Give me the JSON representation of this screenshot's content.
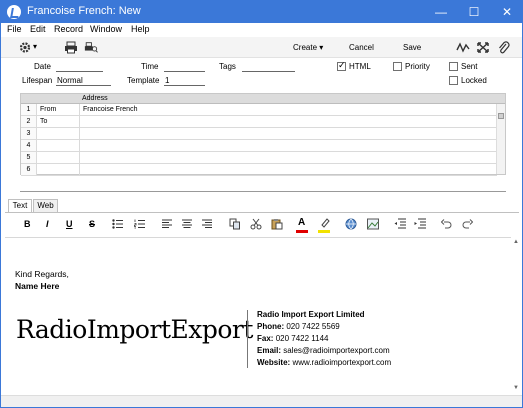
{
  "window": {
    "title": "Francoise French: New"
  },
  "window_controls": {
    "minimize": "—",
    "maximize": "☐",
    "close": "✕"
  },
  "menu": {
    "file": "File",
    "edit": "Edit",
    "record": "Record",
    "window": "Window",
    "help": "Help"
  },
  "toolbar": {
    "create": "Create",
    "cancel": "Cancel",
    "save": "Save",
    "caret": "▾"
  },
  "header": {
    "date_label": "Date",
    "date_value": "",
    "time_label": "Time",
    "time_value": "",
    "tags_label": "Tags",
    "tags_value": "",
    "html_label": "HTML",
    "html_checked": true,
    "priority_label": "Priority",
    "priority_checked": false,
    "sent_label": "Sent",
    "sent_checked": false,
    "lifespan_label": "Lifespan",
    "lifespan_value": "Normal",
    "template_label": "Template",
    "template_value": "1",
    "locked_label": "Locked",
    "locked_checked": false
  },
  "matrix": {
    "column_header": "Address",
    "rows": [
      {
        "num": "1",
        "type": "From",
        "address": "Francoise French"
      },
      {
        "num": "2",
        "type": "To",
        "address": ""
      },
      {
        "num": "3",
        "type": "",
        "address": ""
      },
      {
        "num": "4",
        "type": "",
        "address": ""
      },
      {
        "num": "5",
        "type": "",
        "address": ""
      },
      {
        "num": "6",
        "type": "",
        "address": ""
      }
    ]
  },
  "tabs": {
    "text": "Text",
    "web": "Web"
  },
  "format": {
    "bold": "B",
    "italic": "I",
    "underline": "U",
    "strike": "S"
  },
  "body": {
    "greeting": "Kind Regards,",
    "name": "Name Here",
    "logo_text": "RadioImportExport",
    "company": "Radio Import Export Limited",
    "phone_label": "Phone:",
    "phone_value": "020 7422 5569",
    "fax_label": "Fax:",
    "fax_value": "020 7422 1144",
    "email_label": "Email:",
    "email_value": "sales@radioimportexport.com",
    "website_label": "Website:",
    "website_value": "www.radioimportexport.com"
  },
  "colors": {
    "titlebar": "#3b78d8",
    "toolbar": "#f4f4f4",
    "text_color_underline": "#e00000",
    "highlight_underline": "#f2e200"
  }
}
